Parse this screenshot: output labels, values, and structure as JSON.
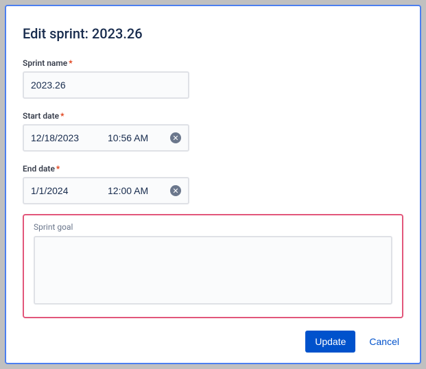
{
  "modal": {
    "title": "Edit sprint: 2023.26"
  },
  "fields": {
    "sprintName": {
      "label": "Sprint name",
      "required": "*",
      "value": "2023.26"
    },
    "startDate": {
      "label": "Start date",
      "required": "*",
      "date": "12/18/2023",
      "time": "10:56 AM"
    },
    "endDate": {
      "label": "End date",
      "required": "*",
      "date": "1/1/2024",
      "time": "12:00 AM"
    },
    "sprintGoal": {
      "label": "Sprint goal",
      "value": ""
    }
  },
  "buttons": {
    "update": "Update",
    "cancel": "Cancel"
  },
  "icons": {
    "clear": "✕"
  }
}
